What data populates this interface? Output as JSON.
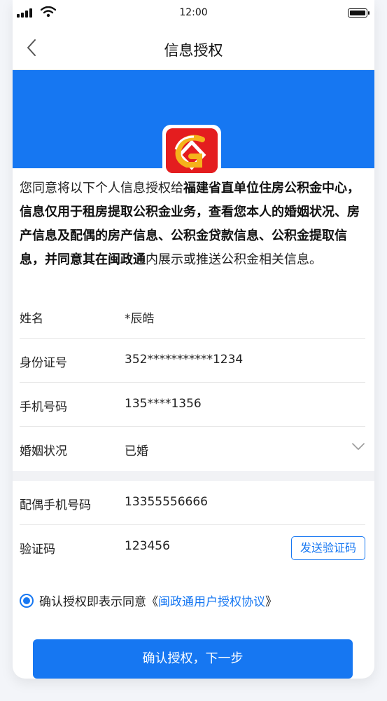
{
  "status": {
    "time": "12:00"
  },
  "nav": {
    "title": "信息授权"
  },
  "notice": {
    "parts": [
      {
        "text": "您同意将以下个人信息授权给",
        "bold": false
      },
      {
        "text": "福建省直单位住房公积金中心，信息仅用于租房提取公积金业务，查看您本人的婚姻状况、房产信息及配偶的房产信息、公积金贷款信息、公积金提取信息，并同意其在闽政通",
        "bold": true
      },
      {
        "text": "内展示或推送公积金相关信息。",
        "bold": false
      }
    ]
  },
  "form": {
    "name": {
      "label": "姓名",
      "value": "*辰皓"
    },
    "id_number": {
      "label": "身份证号",
      "value": "352***********1234"
    },
    "phone": {
      "label": "手机号码",
      "value": "135****1356"
    },
    "marital": {
      "label": "婚姻状况",
      "value": "已婚"
    },
    "spouse_phone": {
      "label": "配偶手机号码",
      "value": "13355556666"
    },
    "code": {
      "label": "验证码",
      "value": "123456",
      "send_label": "发送验证码"
    }
  },
  "agreement": {
    "prefix": "确认授权即表示同意《",
    "link": "闽政通用户授权协议",
    "suffix": "》",
    "checked": true
  },
  "submit": {
    "label": "确认授权，下一步"
  },
  "colors": {
    "primary": "#1677f2",
    "logo_red": "#e41d1f",
    "logo_gold": "#f5b21b"
  }
}
